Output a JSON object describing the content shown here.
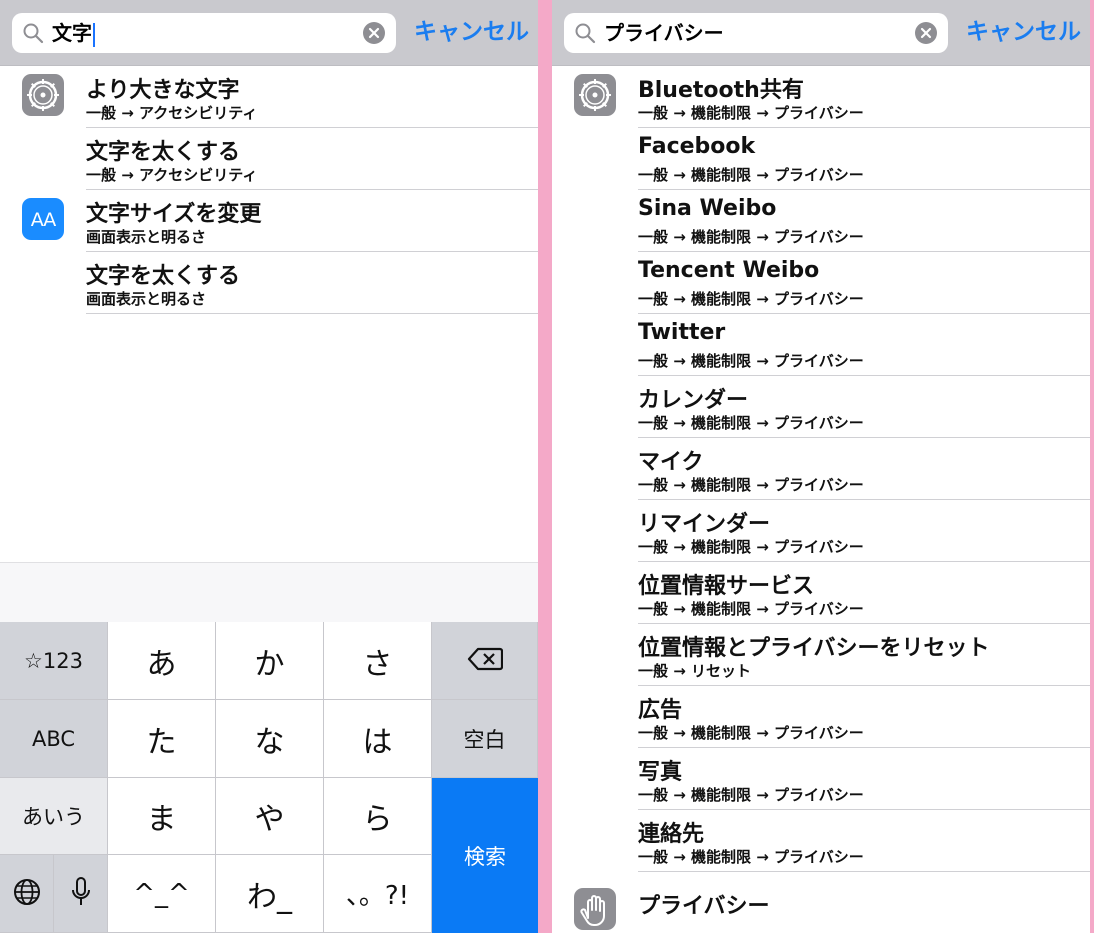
{
  "left": {
    "search": {
      "query": "文字",
      "cancel_label": "キャンセル"
    },
    "results": [
      {
        "title": "より大きな文字",
        "path": "一般 → アクセシビリティ",
        "icon": "gear-icon"
      },
      {
        "title": "文字を太くする",
        "path": "一般 → アクセシビリティ",
        "icon": ""
      },
      {
        "title": "文字サイズを変更",
        "path": "画面表示と明るさ",
        "icon": "text-size-icon",
        "icon_text": "AA"
      },
      {
        "title": "文字を太くする",
        "path": "画面表示と明るさ",
        "icon": ""
      }
    ]
  },
  "keyboard": {
    "keys": {
      "numbers": "☆123",
      "a": "あ",
      "ka": "か",
      "sa": "さ",
      "abc": "ABC",
      "ta": "た",
      "na": "な",
      "ha": "は",
      "space": "空白",
      "aiu": "あいう",
      "ma": "ま",
      "ya": "や",
      "ra": "ら",
      "search": "検索",
      "kaomoji": "^_^",
      "wa": "わ_",
      "punct": "、。?!"
    },
    "icons": [
      "backspace-icon",
      "globe-icon",
      "microphone-icon"
    ],
    "accent_color": "#0a7af5"
  },
  "right": {
    "search": {
      "query": "プライバシー",
      "cancel_label": "キャンセル"
    },
    "results": [
      {
        "title": "Bluetooth共有",
        "path": "一般 → 機能制限 → プライバシー",
        "icon": "gear-icon"
      },
      {
        "title": "Facebook",
        "path": "一般 → 機能制限 → プライバシー"
      },
      {
        "title": "Sina Weibo",
        "path": "一般 → 機能制限 → プライバシー"
      },
      {
        "title": "Tencent Weibo",
        "path": "一般 → 機能制限 → プライバシー"
      },
      {
        "title": "Twitter",
        "path": "一般 → 機能制限 → プライバシー"
      },
      {
        "title": "カレンダー",
        "path": "一般 → 機能制限 → プライバシー"
      },
      {
        "title": "マイク",
        "path": "一般 → 機能制限 → プライバシー"
      },
      {
        "title": "リマインダー",
        "path": "一般 → 機能制限 → プライバシー"
      },
      {
        "title": "位置情報サービス",
        "path": "一般 → 機能制限 → プライバシー"
      },
      {
        "title": "位置情報とプライバシーをリセット",
        "path": "一般 → リセット"
      },
      {
        "title": "広告",
        "path": "一般 → 機能制限 → プライバシー"
      },
      {
        "title": "写真",
        "path": "一般 → 機能制限 → プライバシー"
      },
      {
        "title": "連絡先",
        "path": "一般 → 機能制限 → プライバシー"
      },
      {
        "title": "プライバシー",
        "path": "",
        "icon": "hand-icon"
      }
    ]
  },
  "colors": {
    "link": "#1a7df0",
    "searchbar_bg": "#c9c9ce",
    "divider": "#f4a9c8"
  }
}
